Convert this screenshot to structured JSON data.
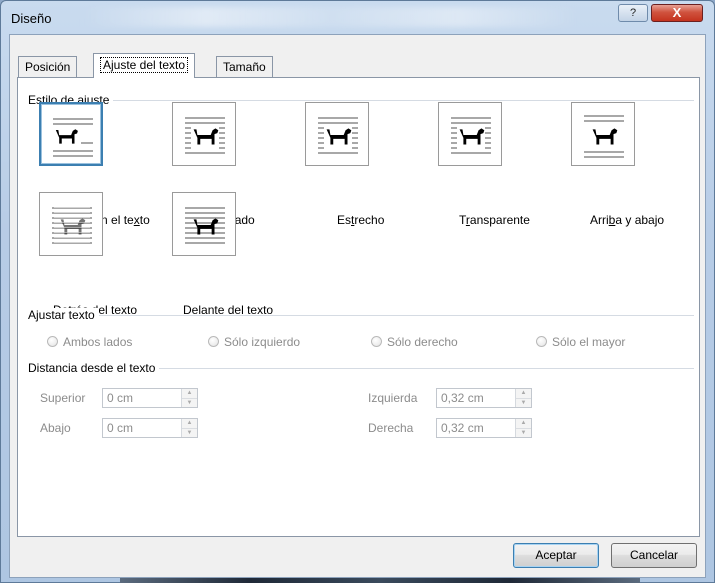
{
  "window": {
    "title": "Diseño",
    "help_label": "?",
    "close_label": "X"
  },
  "tabs": [
    "Posición",
    "Ajuste del texto",
    "Tamaño"
  ],
  "wrap_style": {
    "group_label": "Estilo de ajuste",
    "options": [
      {
        "pre": "En línea con el te",
        "u": "x",
        "post": "to",
        "icon": "inline-wrap-icon",
        "selected": true
      },
      {
        "pre": "",
        "u": "C",
        "post": "uadrado",
        "icon": "square-wrap-icon",
        "selected": false
      },
      {
        "pre": "Es",
        "u": "t",
        "post": "recho",
        "icon": "tight-wrap-icon",
        "selected": false
      },
      {
        "pre": "T",
        "u": "r",
        "post": "ansparente",
        "icon": "through-wrap-icon",
        "selected": false
      },
      {
        "pre": "Arri",
        "u": "b",
        "post": "a y abajo",
        "icon": "top-bottom-wrap-icon",
        "selected": false
      },
      {
        "pre": "",
        "u": "D",
        "post": "etrás del texto",
        "icon": "behind-text-icon",
        "selected": false
      },
      {
        "pre": "D",
        "u": "e",
        "post": "lante del texto",
        "icon": "in-front-text-icon",
        "selected": false
      }
    ]
  },
  "wrap_text": {
    "group_label": "Ajustar texto",
    "options": [
      "Ambos lados",
      "Sólo izquierdo",
      "Sólo derecho",
      "Sólo el mayor"
    ]
  },
  "distance": {
    "group_label": "Distancia desde el texto",
    "top_label": "Superior",
    "top_value": "0 cm",
    "bottom_label": "Abajo",
    "bottom_value": "0 cm",
    "left_label": "Izquierda",
    "left_value": "0,32 cm",
    "right_label": "Derecha",
    "right_value": "0,32 cm"
  },
  "buttons": {
    "ok": "Aceptar",
    "cancel": "Cancelar"
  },
  "colors": {
    "selection_border": "#3c7fb1",
    "close_button": "#c4331e"
  }
}
